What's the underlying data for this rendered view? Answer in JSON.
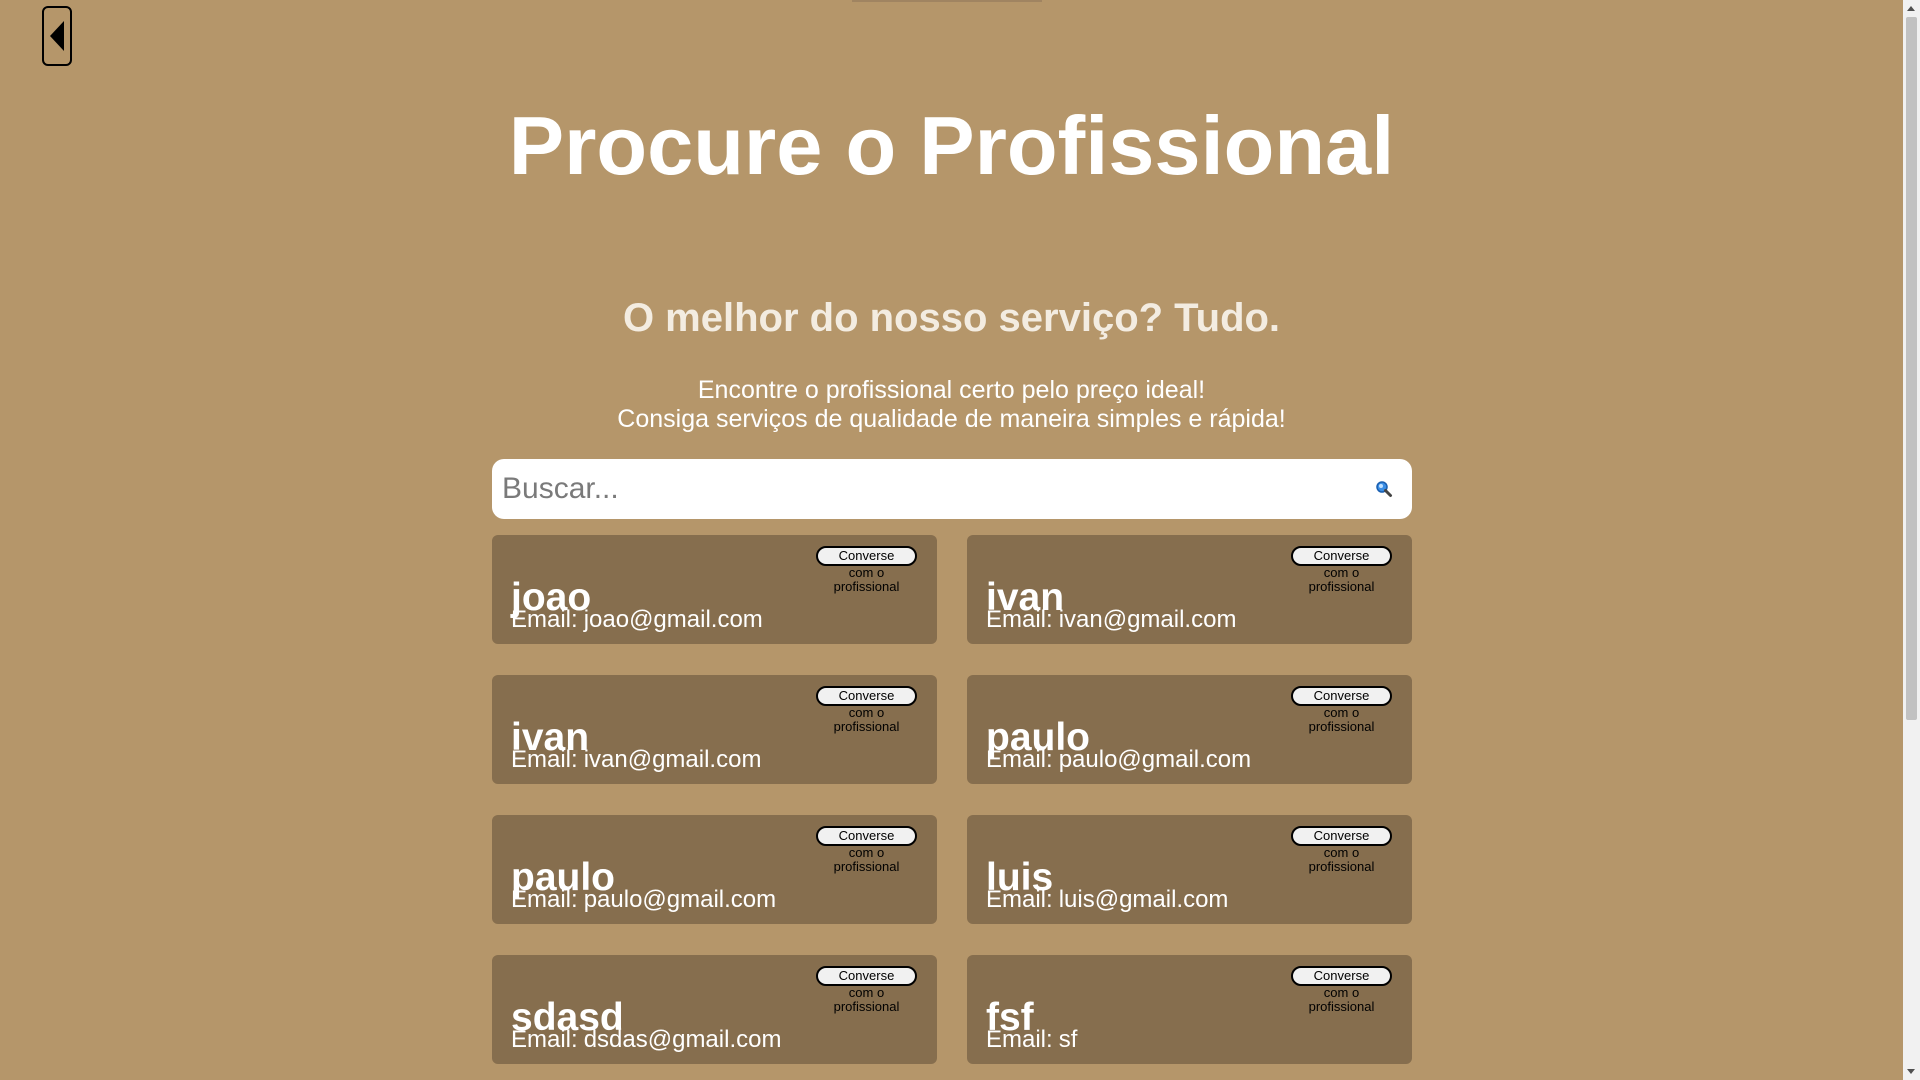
{
  "header": {
    "back_icon": "caret-left-icon",
    "title": "Procure o Profissional"
  },
  "hero": {
    "subtitle": "O melhor do nosso serviço? Tudo.",
    "line1": "Encontre o profissional certo pelo preço ideal!",
    "line2": "Consiga serviços de qualidade de maneira simples e rápida!"
  },
  "search": {
    "placeholder": "Buscar...",
    "value": "",
    "icon": "search-icon"
  },
  "card_labels": {
    "email_label": "Email:",
    "chat_button": "Converse",
    "chat_sub": "com o profissional"
  },
  "professionals": [
    {
      "name": "joao",
      "email": "joao@gmail.com"
    },
    {
      "name": "ivan",
      "email": "ivan@gmail.com"
    },
    {
      "name": "ivan",
      "email": "ivan@gmail.com"
    },
    {
      "name": "paulo",
      "email": "paulo@gmail.com"
    },
    {
      "name": "paulo",
      "email": "paulo@gmail.com"
    },
    {
      "name": "luis",
      "email": "luis@gmail.com"
    },
    {
      "name": "sdasd",
      "email": "dsdas@gmail.com"
    },
    {
      "name": "fsf",
      "email": "sf"
    }
  ],
  "colors": {
    "background": "#b5966a",
    "card": "#866e4e",
    "title": "#ffffff",
    "search_icon": "#1a6fd1"
  }
}
